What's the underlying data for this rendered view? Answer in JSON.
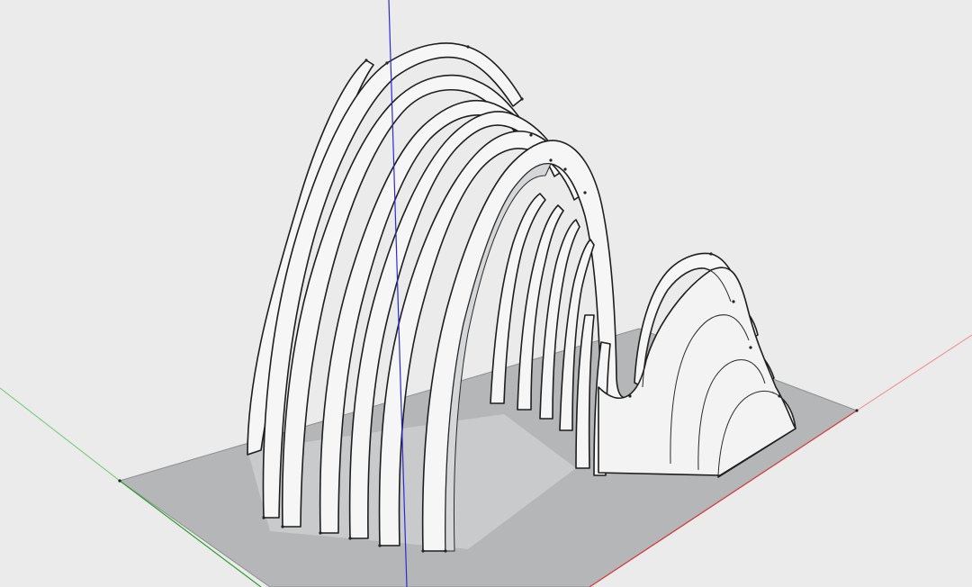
{
  "app": {
    "type": "3d-modeling-viewport"
  },
  "colors": {
    "background": "#ebebeb",
    "ground": "#b4b6b7",
    "model_face": "#f6f6f6",
    "model_shadow": "#d4d6d8",
    "edge": "#1e1e1e",
    "axis_red": "#e03a3a",
    "axis_green": "#2e9e2e",
    "axis_blue": "#2b2bd6"
  },
  "scene": {
    "axes": [
      {
        "name": "red-axis",
        "color_key": "axis_red"
      },
      {
        "name": "green-axis",
        "color_key": "axis_green"
      },
      {
        "name": "blue-axis",
        "color_key": "axis_blue"
      }
    ],
    "model": {
      "description_key": "arched-fin-pavilion",
      "main_arch_count": 7,
      "small_arch_count": 4
    }
  }
}
